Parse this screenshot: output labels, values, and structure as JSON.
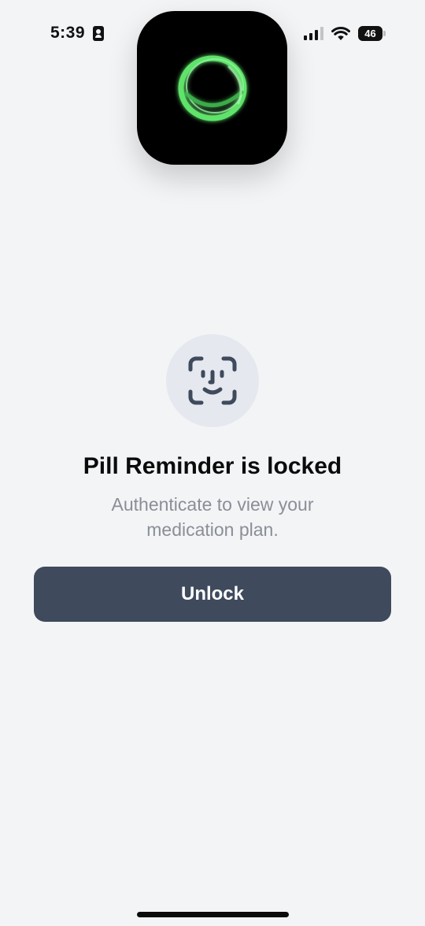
{
  "status_bar": {
    "time": "5:39",
    "battery_level": "46",
    "icons": [
      "contact-card-icon",
      "cellular-signal-icon",
      "wifi-icon",
      "battery-icon"
    ]
  },
  "app_icon": {
    "icon": "green-ring-logo-icon",
    "background_color": "#000000",
    "accent_color": "#5fe36a"
  },
  "lock_screen": {
    "icon": "face-id-icon",
    "title": "Pill Reminder is locked",
    "subtitle": "Authenticate to view your medication plan.",
    "unlock_label": "Unlock"
  },
  "colors": {
    "background": "#f3f4f6",
    "button": "#3f4a5c",
    "subtitle_text": "#8a8e96",
    "faceid_circle": "#e5e8ee",
    "faceid_icon": "#3f4a5c"
  }
}
